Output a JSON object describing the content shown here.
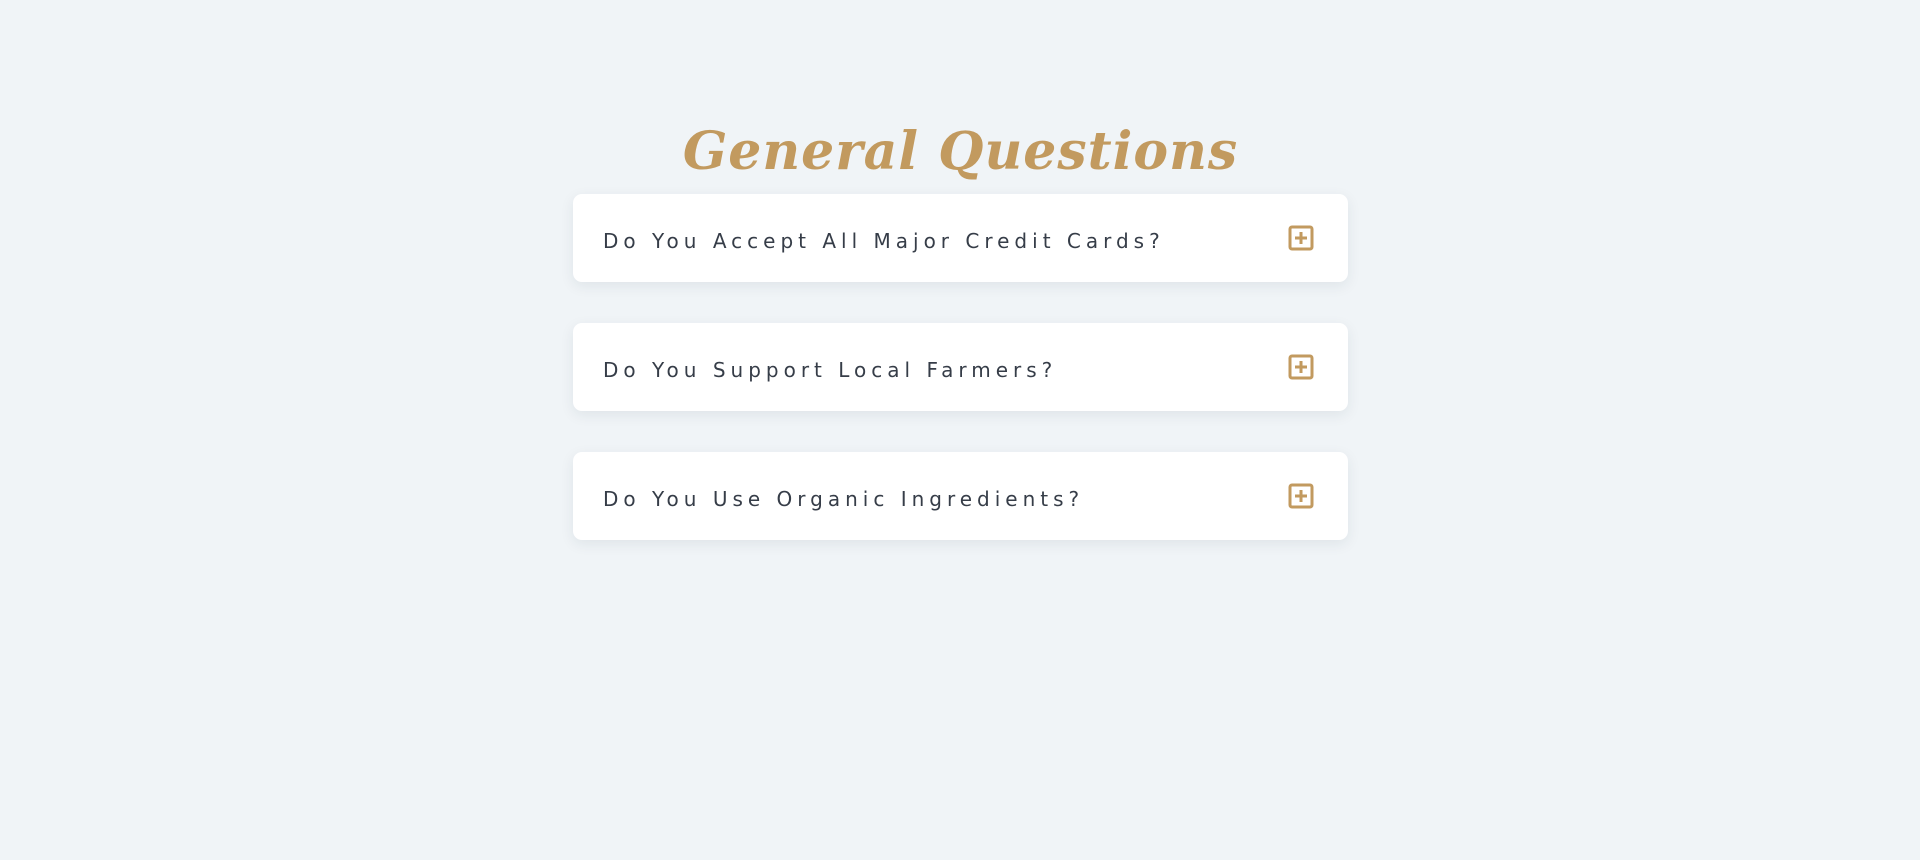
{
  "faq": {
    "title": "General Questions",
    "items": [
      {
        "question": "Do You Accept All Major Credit Cards?",
        "icon": "plus-square-icon"
      },
      {
        "question": "Do You Support Local Farmers?",
        "icon": "plus-square-icon"
      },
      {
        "question": "Do You Use Organic Ingredients?",
        "icon": "plus-square-icon"
      }
    ]
  },
  "colors": {
    "background": "#f0f4f7",
    "accent": "#c29a5f",
    "card": "#ffffff",
    "text": "#363d48"
  }
}
